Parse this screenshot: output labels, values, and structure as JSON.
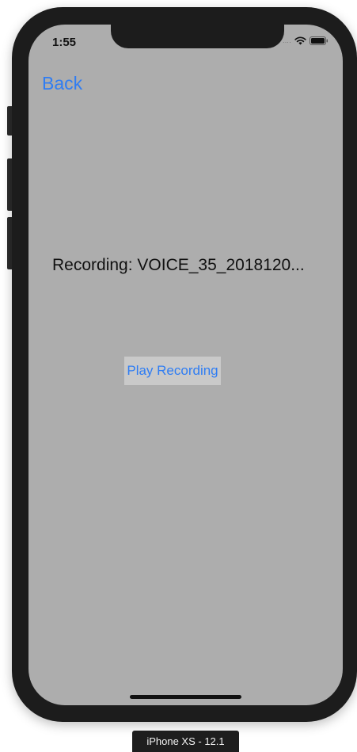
{
  "status_bar": {
    "time": "1:55",
    "signal_dots": "....",
    "wifi_icon": "wifi-icon",
    "battery_icon": "battery-icon"
  },
  "nav": {
    "back_label": "Back"
  },
  "main": {
    "recording_text": "Recording: VOICE_35_2018120...",
    "play_button_label": "Play Recording"
  },
  "simulator": {
    "device_label": "iPhone XS - 12.1"
  },
  "colors": {
    "screen_background": "#adadad",
    "link_blue": "#2f7df3",
    "button_background": "#c9c9c9",
    "device_frame": "#1c1c1c"
  }
}
